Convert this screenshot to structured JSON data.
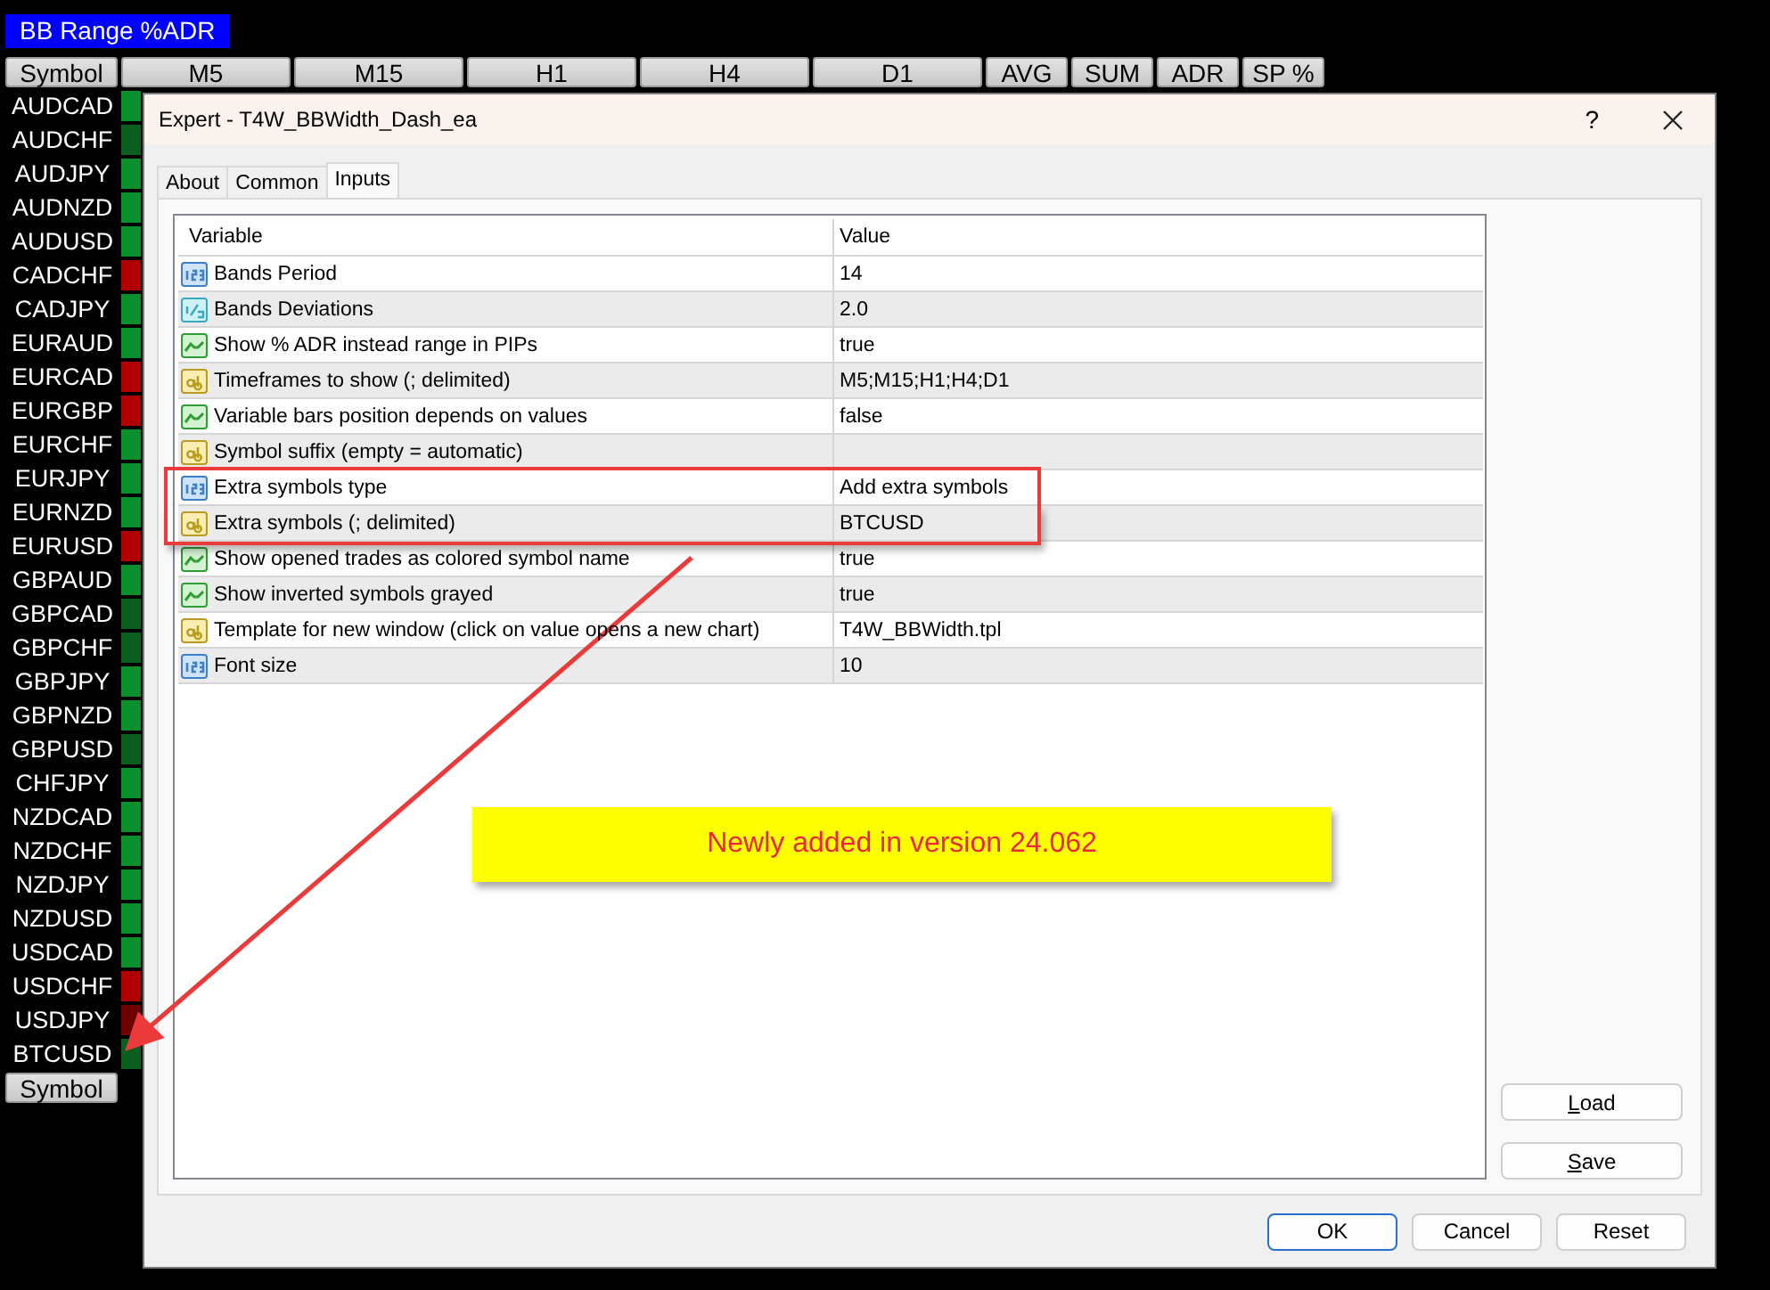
{
  "indicator_label": "BB Range %ADR",
  "header_buttons": [
    {
      "label": "Symbol",
      "kind": "symbol"
    },
    {
      "label": "M5",
      "kind": "timeframe"
    },
    {
      "label": "M15",
      "kind": "timeframe"
    },
    {
      "label": "H1",
      "kind": "timeframe"
    },
    {
      "label": "H4",
      "kind": "timeframe"
    },
    {
      "label": "D1",
      "kind": "timeframe"
    },
    {
      "label": "AVG",
      "kind": "stat"
    },
    {
      "label": "SUM",
      "kind": "stat"
    },
    {
      "label": "ADR",
      "kind": "stat"
    },
    {
      "label": "SP %",
      "kind": "stat"
    }
  ],
  "symbols": [
    {
      "name": "AUDCAD",
      "color": "#0a8f2e"
    },
    {
      "name": "AUDCHF",
      "color": "#0b5e1e"
    },
    {
      "name": "AUDJPY",
      "color": "#0a8f2e"
    },
    {
      "name": "AUDNZD",
      "color": "#0a8f2e"
    },
    {
      "name": "AUDUSD",
      "color": "#0a8f2e"
    },
    {
      "name": "CADCHF",
      "color": "#b00000"
    },
    {
      "name": "CADJPY",
      "color": "#0a8f2e"
    },
    {
      "name": "EURAUD",
      "color": "#0a8f2e"
    },
    {
      "name": "EURCAD",
      "color": "#b00000"
    },
    {
      "name": "EURGBP",
      "color": "#b00000"
    },
    {
      "name": "EURCHF",
      "color": "#0a8f2e"
    },
    {
      "name": "EURJPY",
      "color": "#0a8f2e"
    },
    {
      "name": "EURNZD",
      "color": "#0a8f2e"
    },
    {
      "name": "EURUSD",
      "color": "#b00000"
    },
    {
      "name": "GBPAUD",
      "color": "#0a8f2e"
    },
    {
      "name": "GBPCAD",
      "color": "#0b5e1e"
    },
    {
      "name": "GBPCHF",
      "color": "#0b5e1e"
    },
    {
      "name": "GBPJPY",
      "color": "#0a8f2e"
    },
    {
      "name": "GBPNZD",
      "color": "#0a8f2e"
    },
    {
      "name": "GBPUSD",
      "color": "#0b5e1e"
    },
    {
      "name": "CHFJPY",
      "color": "#0a8f2e"
    },
    {
      "name": "NZDCAD",
      "color": "#0a8f2e"
    },
    {
      "name": "NZDCHF",
      "color": "#0a8f2e"
    },
    {
      "name": "NZDJPY",
      "color": "#0a8f2e"
    },
    {
      "name": "NZDUSD",
      "color": "#0a8f2e"
    },
    {
      "name": "USDCAD",
      "color": "#0a8f2e"
    },
    {
      "name": "USDCHF",
      "color": "#b00000"
    },
    {
      "name": "USDJPY",
      "color": "#6e0000"
    },
    {
      "name": "BTCUSD",
      "color": "#0b5e1e"
    }
  ],
  "footer_button": "Symbol",
  "dialog": {
    "title": "Expert - T4W_BBWidth_Dash_ea",
    "help": "?",
    "tabs": [
      {
        "label": "About",
        "selected": false
      },
      {
        "label": "Common",
        "selected": false
      },
      {
        "label": "Inputs",
        "selected": true
      }
    ],
    "table": {
      "columns": [
        "Variable",
        "Value"
      ],
      "rows": [
        {
          "kind": "int",
          "variable": "Bands Period",
          "value": "14",
          "highlighted": false
        },
        {
          "kind": "double",
          "variable": "Bands Deviations",
          "value": "2.0",
          "highlighted": false
        },
        {
          "kind": "bool",
          "variable": "Show % ADR instead range in PIPs",
          "value": "true",
          "highlighted": false
        },
        {
          "kind": "string",
          "variable": "Timeframes to show (; delimited)",
          "value": "M5;M15;H1;H4;D1",
          "highlighted": false
        },
        {
          "kind": "bool",
          "variable": "Variable bars position depends on values",
          "value": "false",
          "highlighted": false
        },
        {
          "kind": "string",
          "variable": "Symbol suffix (empty = automatic)",
          "highlighted": false
        },
        {
          "kind": "int",
          "variable": "Extra symbols type",
          "value": "Add extra symbols",
          "highlighted": true
        },
        {
          "kind": "string",
          "variable": "Extra symbols (; delimited)",
          "value": "BTCUSD",
          "highlighted": true
        },
        {
          "kind": "bool",
          "variable": "Show opened trades as colored symbol name",
          "value": "true",
          "highlighted": false
        },
        {
          "kind": "bool",
          "variable": "Show inverted symbols grayed",
          "value": "true",
          "highlighted": false
        },
        {
          "kind": "string",
          "variable": "Template for new window (click on value opens a new chart)",
          "value": "T4W_BBWidth.tpl",
          "highlighted": false
        },
        {
          "kind": "int",
          "variable": "Font size",
          "value": "10",
          "highlighted": false
        }
      ]
    },
    "side_buttons": [
      "Load",
      "Save"
    ],
    "buttons": [
      {
        "label": "OK",
        "default": true
      },
      {
        "label": "Cancel",
        "default": false
      },
      {
        "label": "Reset",
        "default": false
      }
    ]
  },
  "annotation": {
    "note": "Newly added in version 24.062"
  }
}
